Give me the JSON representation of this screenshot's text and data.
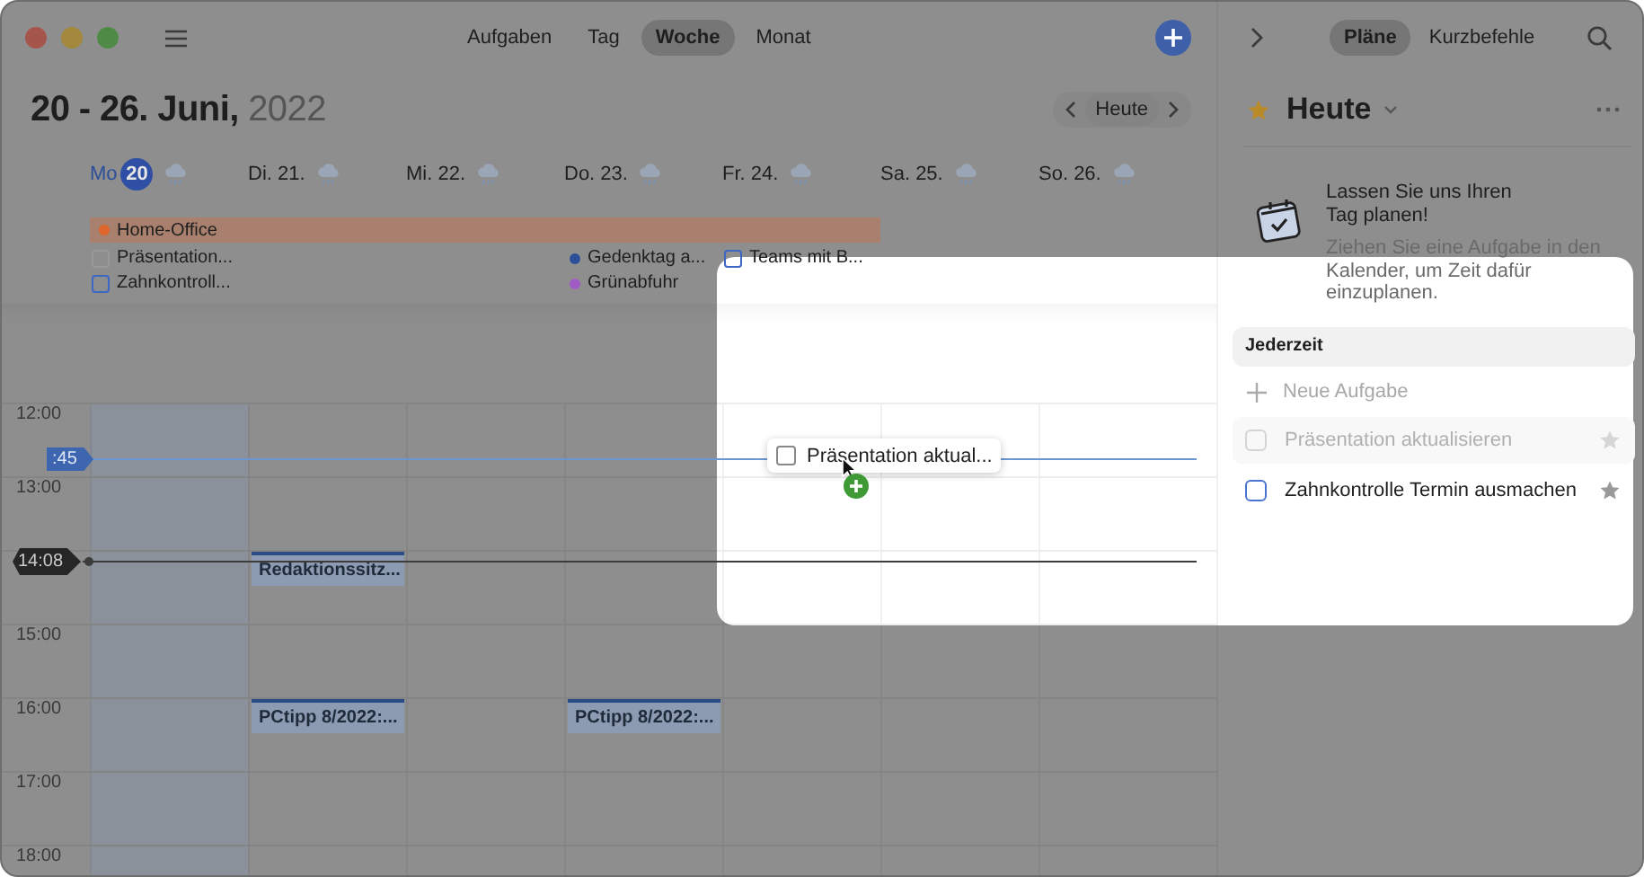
{
  "toolbar": {
    "tabs": [
      {
        "label": "Aufgaben",
        "selected": false
      },
      {
        "label": "Tag",
        "selected": false
      },
      {
        "label": "Woche",
        "selected": true
      },
      {
        "label": "Monat",
        "selected": false
      }
    ]
  },
  "header": {
    "range": "20 - 26. Juni,",
    "year": "2022",
    "today_button": "Heute"
  },
  "days": [
    {
      "weekday": "Mo",
      "date": "20",
      "today": true,
      "all_day": [
        {
          "kind": "task",
          "title": "Präsentation...",
          "color": "#9a9a9a"
        },
        {
          "kind": "task",
          "title": "Zahnkontroll...",
          "color": "#3b66c4"
        }
      ]
    },
    {
      "weekday": "Di.",
      "date": "21.",
      "today": false
    },
    {
      "weekday": "Mi.",
      "date": "22.",
      "today": false
    },
    {
      "weekday": "Do.",
      "date": "23.",
      "today": false,
      "all_day": [
        {
          "kind": "event",
          "title": "Gedenktag a...",
          "color": "#2d4f9a"
        },
        {
          "kind": "event",
          "title": "Grünabfuhr",
          "color": "#a05cc4"
        }
      ]
    },
    {
      "weekday": "Fr.",
      "date": "24.",
      "today": false,
      "all_day": [
        {
          "kind": "task",
          "title": "Teams mit B...",
          "color": "#3b66c4"
        }
      ]
    },
    {
      "weekday": "Sa.",
      "date": "25.",
      "today": false
    },
    {
      "weekday": "So.",
      "date": "26.",
      "today": false
    }
  ],
  "all_day_banner": {
    "title": "Home-Office",
    "color": "#e0662e",
    "covers": [
      true,
      true,
      true,
      true,
      true,
      false,
      false
    ]
  },
  "hours": [
    {
      "label": "12:00"
    },
    {
      "label": "13:00"
    },
    {
      "cells": [
        null,
        {
          "title": "Redaktionssitz..."
        },
        null,
        null,
        null,
        null,
        null
      ]
    },
    {
      "label": "15:00"
    },
    {
      "label": "16:00",
      "cells": [
        null,
        {
          "title": "PCtipp 8/2022:..."
        },
        null,
        {
          "title": "PCtipp 8/2022:..."
        },
        null,
        null,
        null
      ]
    },
    {
      "label": "17:00"
    },
    {
      "label": "18:00"
    }
  ],
  "indicators": {
    "drop_time": ":45",
    "current_time": "14:08"
  },
  "drag_chip": {
    "title": "Präsentation aktual..."
  },
  "sidebar": {
    "tabs": [
      {
        "label": "Pläne",
        "selected": true
      },
      {
        "label": "Kurzbefehle",
        "selected": false
      }
    ],
    "title": "Heute",
    "promo": {
      "heading": "Lassen Sie uns Ihren Tag planen!",
      "text": "Ziehen Sie eine Aufgabe in den Kalender, um Zeit dafür einzuplanen."
    },
    "section": "Jederzeit",
    "new_task": "Neue Aufgabe",
    "tasks": [
      {
        "title": "Präsentation aktualisieren",
        "dragging": true
      },
      {
        "title": "Zahnkontrolle Termin ausmachen",
        "dragging": false
      }
    ]
  }
}
